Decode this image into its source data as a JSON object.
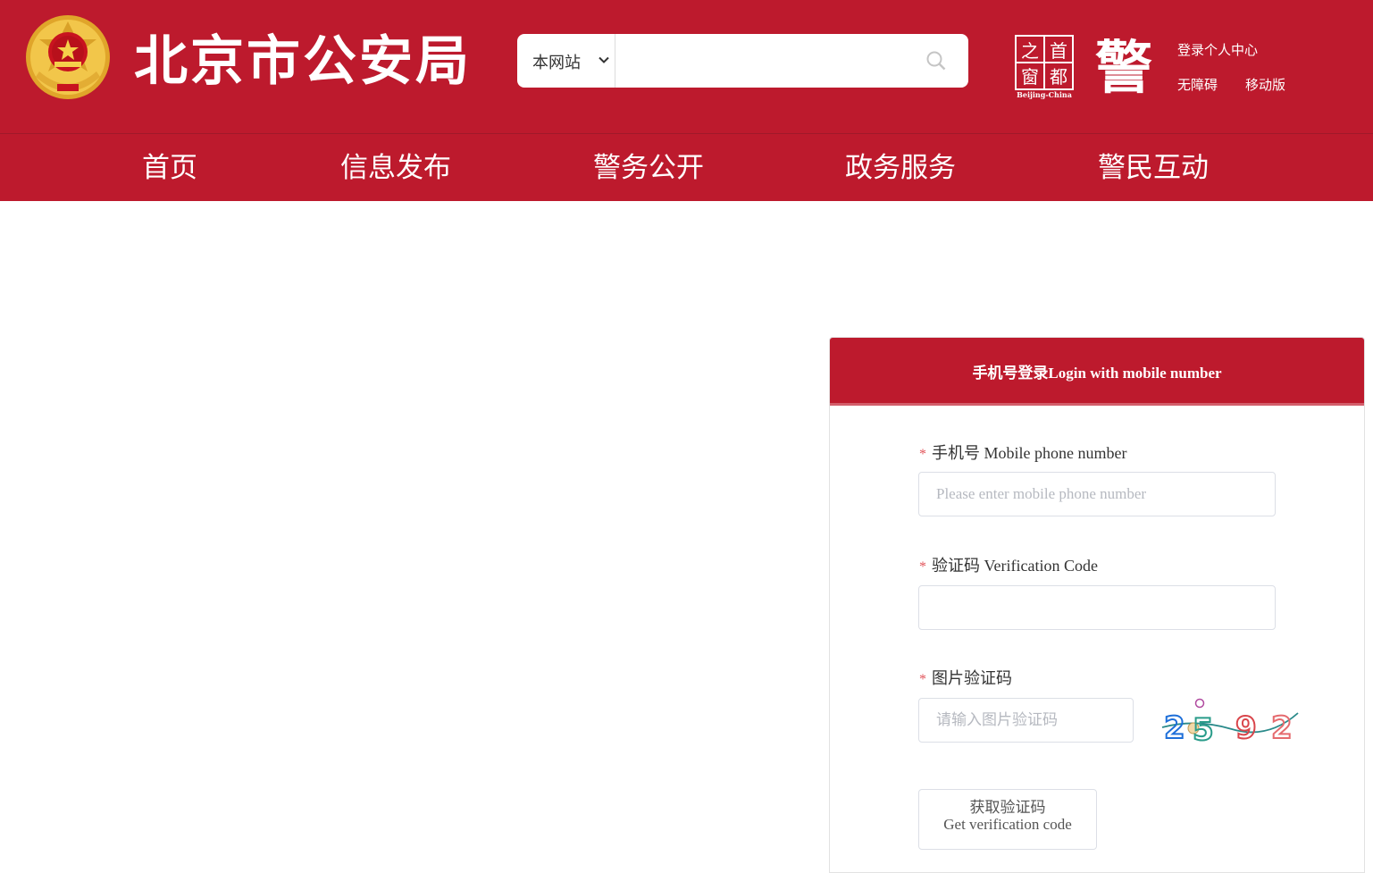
{
  "header": {
    "title": "北京市公安局",
    "search": {
      "scope_selected": "本网站",
      "query": "",
      "placeholder": ""
    },
    "capital_logo": {
      "chars": [
        "之",
        "首",
        "窗",
        "都"
      ],
      "subtitle": "Beijing-China"
    },
    "jing_logo_char": "警",
    "links": {
      "login_center": "登录个人中心",
      "accessibility": "无障碍",
      "mobile": "移动版"
    }
  },
  "nav": {
    "items": [
      "首页",
      "信息发布",
      "警务公开",
      "政务服务",
      "警民互动"
    ]
  },
  "login": {
    "title": "手机号登录Login with mobile number",
    "required_mark": "*",
    "phone": {
      "label": "手机号 Mobile phone number",
      "placeholder": "Please enter mobile phone number",
      "value": ""
    },
    "code": {
      "label": "验证码 Verification Code",
      "placeholder": "",
      "value": ""
    },
    "image_code": {
      "label": "图片验证码",
      "placeholder": "请输入图片验证码",
      "value": "",
      "captcha_chars": [
        "2",
        "5",
        "9",
        "2"
      ]
    },
    "get_code_button": {
      "line1": "获取验证码",
      "line2": "Get verification code"
    }
  },
  "colors": {
    "brand_red": "#bd1a2d",
    "required_mark": "#e2555b",
    "captcha": [
      "#1e6fd9",
      "#2a9c8a",
      "#d9454b",
      "#e56a6e"
    ]
  },
  "icons": {
    "emblem": "police-emblem-icon",
    "search": "search-icon",
    "dropdown": "chevron-down-icon"
  }
}
